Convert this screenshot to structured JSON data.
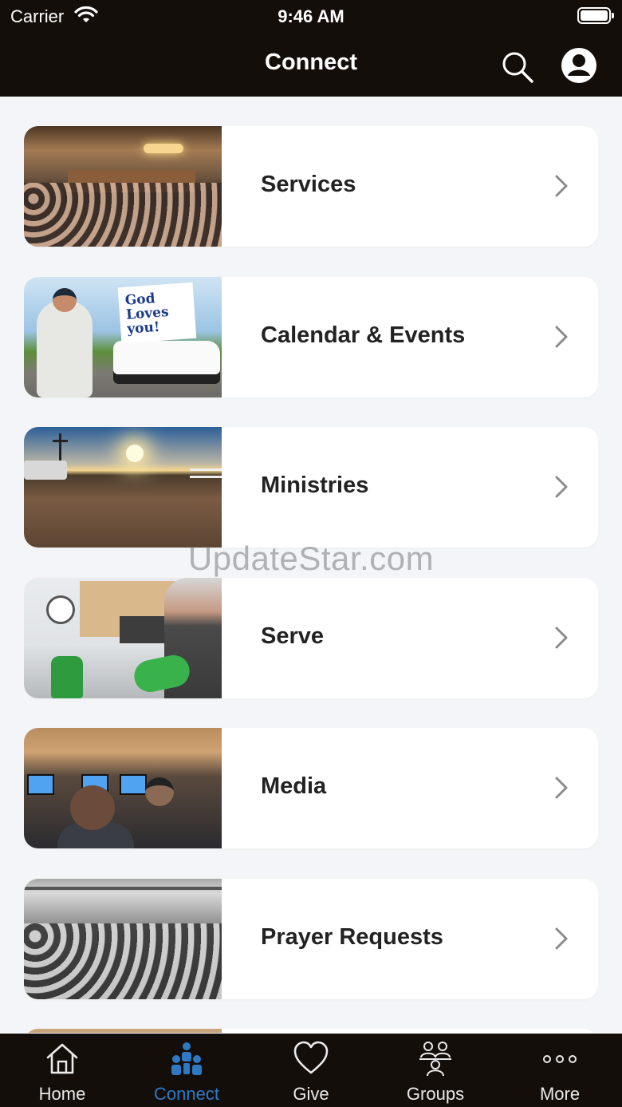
{
  "status_bar": {
    "carrier": "Carrier",
    "time": "9:46 AM"
  },
  "nav": {
    "title": "Connect",
    "search_icon": "search-icon",
    "profile_icon": "account-icon"
  },
  "items": [
    {
      "label": "Services",
      "thumb": "services"
    },
    {
      "label": "Calendar & Events",
      "thumb": "calendar",
      "sign_text": "God Loves you!"
    },
    {
      "label": "Ministries",
      "thumb": "ministries"
    },
    {
      "label": "Serve",
      "thumb": "serve"
    },
    {
      "label": "Media",
      "thumb": "media"
    },
    {
      "label": "Prayer Requests",
      "thumb": "prayer"
    }
  ],
  "watermark": "UpdateStar.com",
  "tabs": [
    {
      "label": "Home",
      "icon": "home-icon",
      "active": false
    },
    {
      "label": "Connect",
      "icon": "connect-icon",
      "active": true
    },
    {
      "label": "Give",
      "icon": "heart-icon",
      "active": false
    },
    {
      "label": "Groups",
      "icon": "groups-icon",
      "active": false
    },
    {
      "label": "More",
      "icon": "more-icon",
      "active": false
    }
  ],
  "colors": {
    "bar_background": "#140e0b",
    "active_tab": "#2f78c2",
    "page_background": "#f4f5f8"
  }
}
